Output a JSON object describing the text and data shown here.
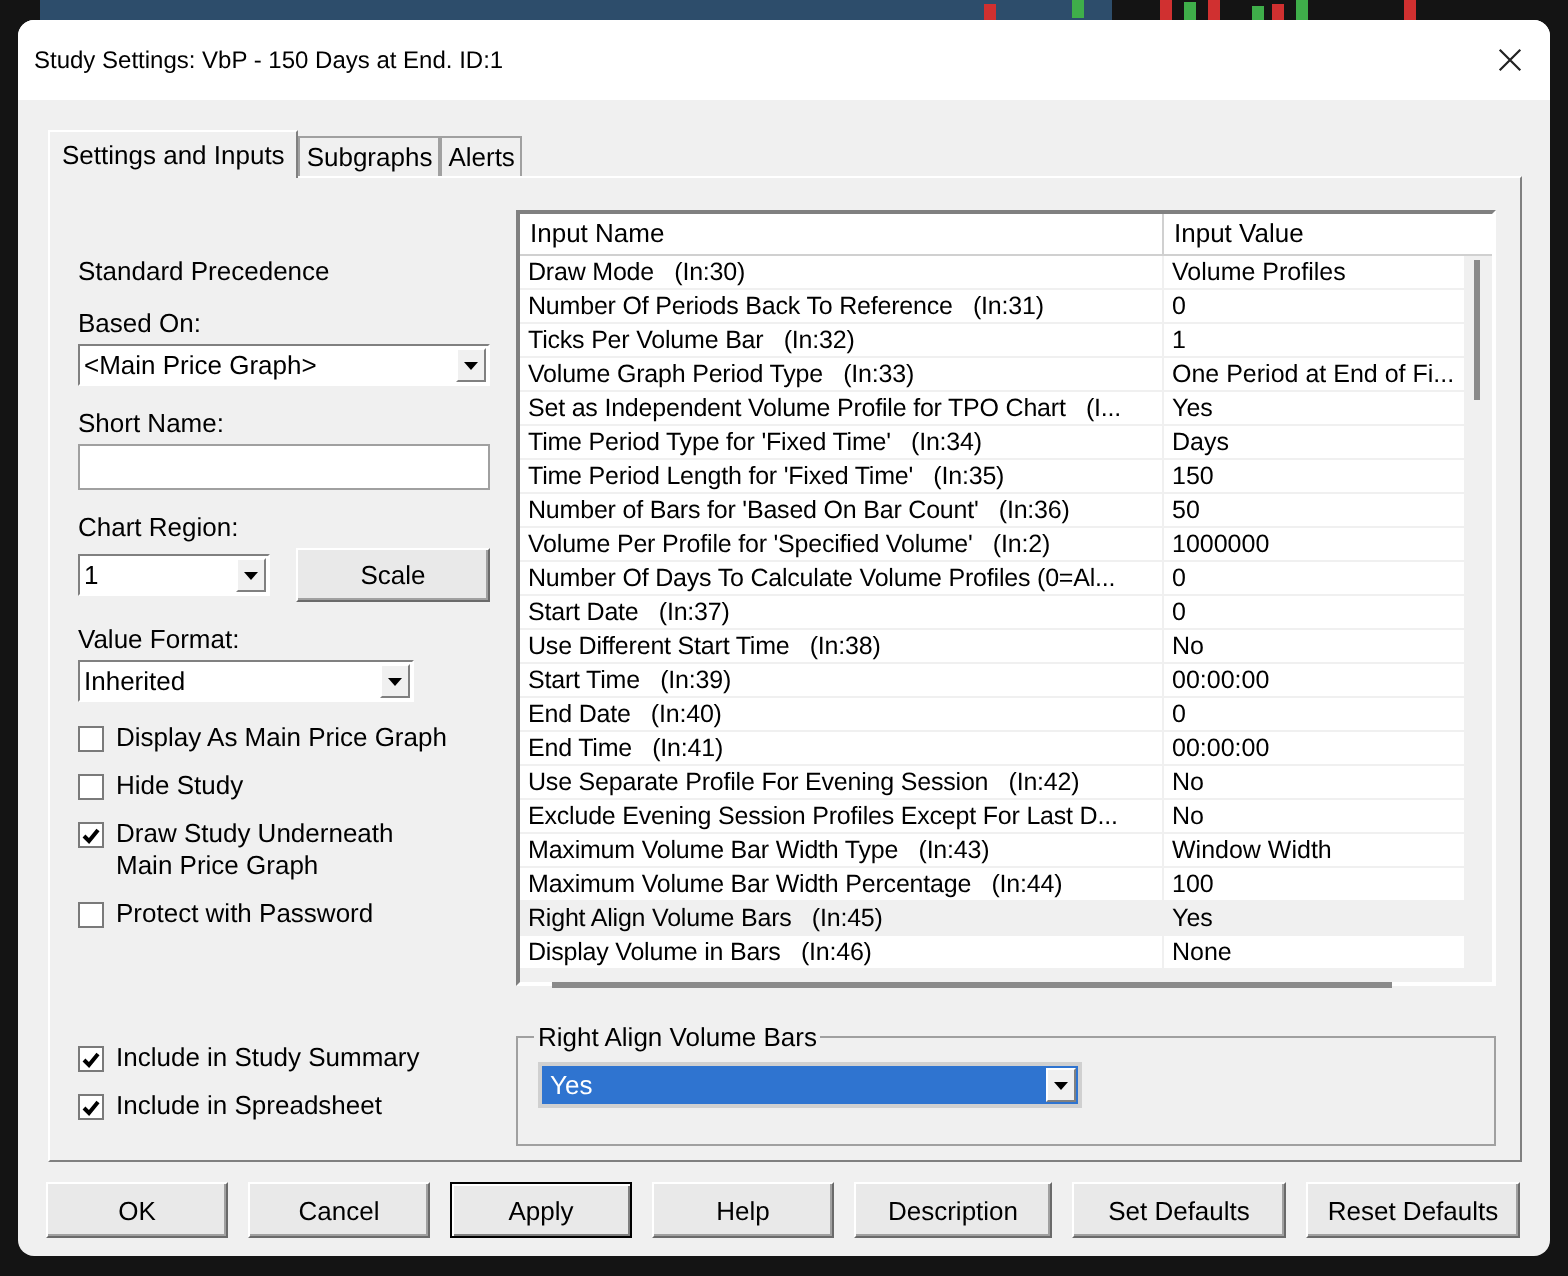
{
  "window": {
    "title": "Study Settings: VbP - 150 Days at End. ID:1"
  },
  "tabs": [
    {
      "label": "Settings and Inputs",
      "selected": true
    },
    {
      "label": "Subgraphs",
      "selected": false
    },
    {
      "label": "Alerts",
      "selected": false
    }
  ],
  "left_panel": {
    "heading": "Standard Precedence",
    "based_on": {
      "label": "Based On:",
      "value": "<Main Price Graph>"
    },
    "short_name": {
      "label": "Short Name:"
    },
    "chart_region": {
      "label": "Chart Region:",
      "value": "1"
    },
    "scale_button": "Scale",
    "value_format": {
      "label": "Value Format:",
      "value": "Inherited"
    },
    "options": [
      {
        "label": "Display As Main Price Graph",
        "checked": false
      },
      {
        "label": "Hide Study",
        "checked": false
      },
      {
        "label": "Draw Study Underneath Main Price Graph",
        "checked": true
      },
      {
        "label": "Protect with Password",
        "checked": false
      }
    ],
    "summary_options": [
      {
        "label": "Include in Study Summary",
        "checked": true
      },
      {
        "label": "Include in Spreadsheet",
        "checked": true
      }
    ]
  },
  "inputs_table": {
    "columns": [
      "Input Name",
      "Input Value"
    ],
    "rows": [
      {
        "name": "Draw Mode   (In:30)",
        "value": "Volume Profiles",
        "selected": false
      },
      {
        "name": "Number Of Periods Back To Reference   (In:31)",
        "value": "0",
        "selected": false
      },
      {
        "name": "Ticks Per Volume Bar   (In:32)",
        "value": "1",
        "selected": false
      },
      {
        "name": "Volume Graph Period Type   (In:33)",
        "value": "One Period at End of Fi...",
        "selected": false
      },
      {
        "name": "Set as Independent Volume Profile for TPO Chart   (I...",
        "value": "Yes",
        "selected": false
      },
      {
        "name": "Time Period Type for 'Fixed Time'   (In:34)",
        "value": "Days",
        "selected": false
      },
      {
        "name": "Time Period Length for 'Fixed Time'   (In:35)",
        "value": "150",
        "selected": false
      },
      {
        "name": "Number of Bars for 'Based On Bar Count'   (In:36)",
        "value": "50",
        "selected": false
      },
      {
        "name": "Volume Per Profile for 'Specified Volume'   (In:2)",
        "value": "1000000",
        "selected": false
      },
      {
        "name": "Number Of Days To Calculate Volume Profiles (0=Al...",
        "value": "0",
        "selected": false
      },
      {
        "name": "Start Date   (In:37)",
        "value": "0",
        "selected": false
      },
      {
        "name": "Use Different Start Time   (In:38)",
        "value": "No",
        "selected": false
      },
      {
        "name": "Start Time   (In:39)",
        "value": "00:00:00",
        "selected": false
      },
      {
        "name": "End Date   (In:40)",
        "value": "0",
        "selected": false
      },
      {
        "name": "End Time   (In:41)",
        "value": "00:00:00",
        "selected": false
      },
      {
        "name": "Use Separate Profile For Evening Session   (In:42)",
        "value": "No",
        "selected": false
      },
      {
        "name": "Exclude Evening Session Profiles Except For Last D...",
        "value": "No",
        "selected": false
      },
      {
        "name": "Maximum Volume Bar Width Type   (In:43)",
        "value": "Window Width",
        "selected": false
      },
      {
        "name": "Maximum Volume Bar Width Percentage   (In:44)",
        "value": "100",
        "selected": false
      },
      {
        "name": "Right Align Volume Bars   (In:45)",
        "value": "Yes",
        "selected": true
      },
      {
        "name": "Display Volume in Bars   (In:46)",
        "value": "None",
        "selected": false
      }
    ]
  },
  "selected_input": {
    "title": "Right Align Volume Bars",
    "value": "Yes"
  },
  "buttons": [
    {
      "label": "OK",
      "focused": false
    },
    {
      "label": "Cancel",
      "focused": false
    },
    {
      "label": "Apply",
      "focused": true
    },
    {
      "label": "Help",
      "focused": false
    },
    {
      "label": "Description",
      "focused": false
    },
    {
      "label": "Set Defaults",
      "focused": false
    },
    {
      "label": "Reset Defaults",
      "focused": false
    }
  ]
}
